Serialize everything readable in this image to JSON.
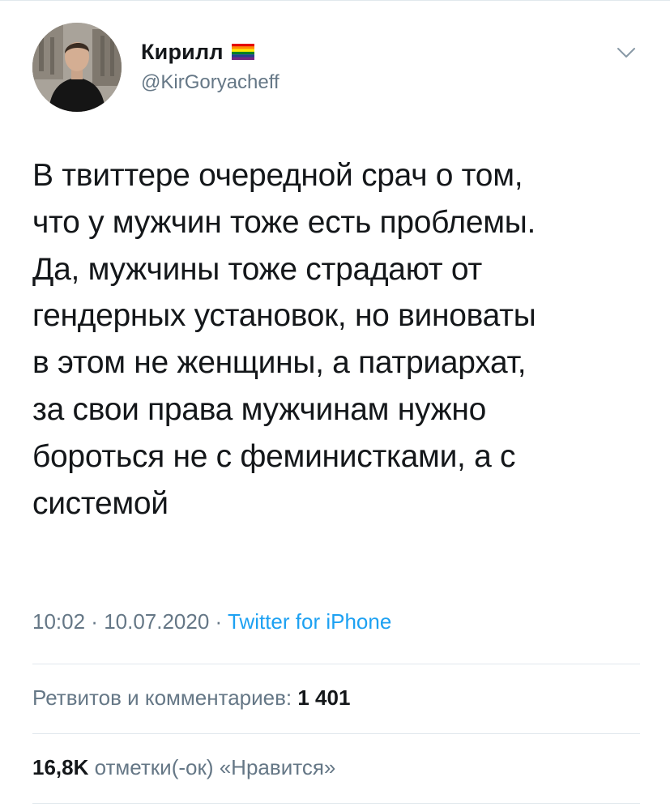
{
  "user": {
    "display_name": "Кирилл",
    "flag_icon": "rainbow-flag-icon",
    "handle": "@KirGoryacheff",
    "avatar_icon": "avatar-photo"
  },
  "menu_icon": "chevron-down-icon",
  "tweet": {
    "text": "В твиттере очередной срач о том,\nчто у мужчин тоже есть проблемы.\nДа, мужчины тоже страдают от\nгендерных установок, но виноваты\nв этом не женщины, а патриархат,\nза свои права мужчинам нужно\nбороться не с феминистками, а с\nсистемой"
  },
  "meta": {
    "time": "10:02",
    "separator_1": " · ",
    "date": "10.07.2020",
    "separator_2": " · ",
    "source": "Twitter for iPhone"
  },
  "stats": {
    "retweets_label": "Ретвитов и комментариев: ",
    "retweets_count": "1 401",
    "likes_count": "16,8K",
    "likes_label": " отметки(-ок) «Нравится»"
  },
  "colors": {
    "text": "#14171a",
    "secondary": "#657786",
    "link": "#1da1f2",
    "divider": "#e1e8ed"
  }
}
